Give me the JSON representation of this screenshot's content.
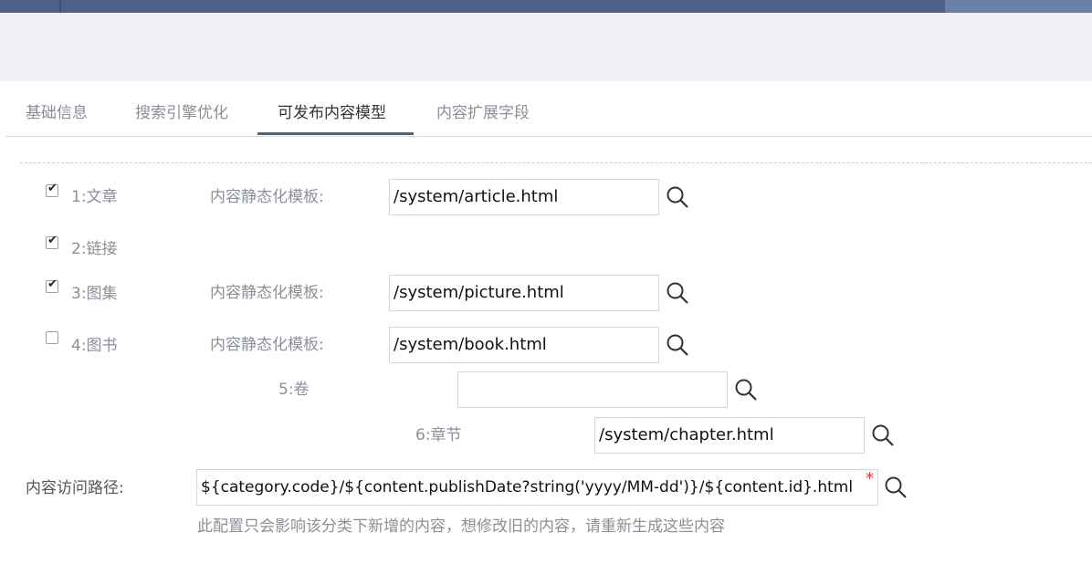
{
  "tabs": [
    "基础信息",
    "搜索引擎优化",
    "可发布内容模型",
    "内容扩展字段"
  ],
  "active_tab": "可发布内容模型",
  "models": {
    "m1": {
      "label": "1:文章",
      "checked": true,
      "template_label": "内容静态化模板:",
      "template": "/system/article.html"
    },
    "m2": {
      "label": "2:链接",
      "checked": true
    },
    "m3": {
      "label": "3:图集",
      "checked": true,
      "template_label": "内容静态化模板:",
      "template": "/system/picture.html"
    },
    "m4": {
      "label": "4:图书",
      "checked": false,
      "template_label": "内容静态化模板:",
      "template": "/system/book.html"
    },
    "m5": {
      "label": "5:卷",
      "template": ""
    },
    "m6": {
      "label": "6:章节",
      "template": "/system/chapter.html"
    }
  },
  "access_path": {
    "label": "内容访问路径:",
    "value": "${category.code}/${content.publishDate?string('yyyy/MM-dd')}/${content.id}.html",
    "required_mark": "*",
    "hint": "此配置只会影响该分类下新增的内容，想修改旧的内容，请重新生成这些内容"
  },
  "icons": {
    "search": "magnifier-icon",
    "check": "checkmark-icon"
  },
  "colors": {
    "topbar": "#4e6188",
    "accent": "#4e6188",
    "required": "#e33333"
  }
}
